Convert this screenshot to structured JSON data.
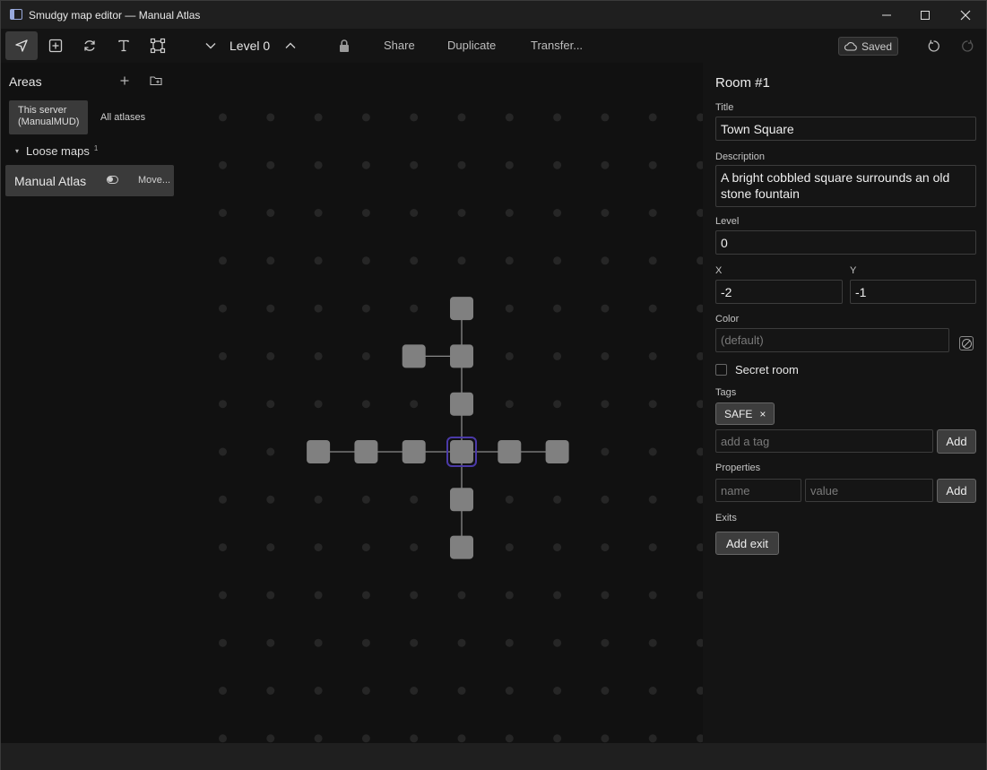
{
  "window": {
    "title": "Smudgy map editor — Manual Atlas",
    "minimize": "—",
    "maximize": "☐",
    "close": "✕"
  },
  "toolbar": {
    "tools": [
      {
        "name": "select-tool",
        "icon": "navigation-arrow-icon",
        "active": true
      },
      {
        "name": "add-room-tool",
        "icon": "plus-square-icon",
        "active": false
      },
      {
        "name": "connect-tool",
        "icon": "refresh-icon",
        "active": false
      },
      {
        "name": "text-tool",
        "icon": "text-t-icon",
        "active": false
      },
      {
        "name": "area-select-tool",
        "icon": "frame-select-icon",
        "active": false
      }
    ],
    "level_label": "Level 0",
    "share": "Share",
    "duplicate": "Duplicate",
    "transfer": "Transfer...",
    "saved": "Saved"
  },
  "sidebar": {
    "title": "Areas",
    "tabs": {
      "this_server": "This server (ManualMUD)",
      "all_atlases": "All atlases"
    },
    "loose_maps": "Loose maps",
    "loose_maps_count": "1",
    "atlas_name": "Manual Atlas",
    "atlas_move": "Move..."
  },
  "map": {
    "rooms": [
      {
        "id": "r-north2",
        "x": 0,
        "y": -3
      },
      {
        "id": "r-north1",
        "x": 0,
        "y": -2
      },
      {
        "id": "r-northwest",
        "x": -1,
        "y": -2
      },
      {
        "id": "r-north0",
        "x": 0,
        "y": -1
      },
      {
        "id": "r-center",
        "x": 0,
        "y": 0,
        "selected": true
      },
      {
        "id": "r-west1",
        "x": -1,
        "y": 0
      },
      {
        "id": "r-west2",
        "x": -2,
        "y": 0
      },
      {
        "id": "r-west3",
        "x": -3,
        "y": 0
      },
      {
        "id": "r-east1",
        "x": 1,
        "y": 0
      },
      {
        "id": "r-east2",
        "x": 2,
        "y": 0
      },
      {
        "id": "r-south1",
        "x": 0,
        "y": 1
      },
      {
        "id": "r-south2",
        "x": 0,
        "y": 2
      }
    ],
    "exits": [
      [
        "r-north2",
        "r-north1"
      ],
      [
        "r-northwest",
        "r-north1"
      ],
      [
        "r-north1",
        "r-north0"
      ],
      [
        "r-north0",
        "r-center"
      ],
      [
        "r-west3",
        "r-west2"
      ],
      [
        "r-west2",
        "r-west1"
      ],
      [
        "r-west1",
        "r-center"
      ],
      [
        "r-center",
        "r-east1"
      ],
      [
        "r-east1",
        "r-east2"
      ],
      [
        "r-center",
        "r-south1"
      ],
      [
        "r-south1",
        "r-south2"
      ]
    ],
    "colors": {
      "room": "#808080",
      "selected_outline": "#4b3aa8",
      "exit_line": "#8a8a8a",
      "grid_dot": "#262626"
    }
  },
  "room_panel": {
    "heading": "Room #1",
    "title_label": "Title",
    "title_value": "Town Square",
    "description_label": "Description",
    "description_value": "A bright cobbled square surrounds an old stone fountain",
    "level_label": "Level",
    "level_value": "0",
    "x_label": "X",
    "x_value": "-2",
    "y_label": "Y",
    "y_value": "-1",
    "color_label": "Color",
    "color_placeholder": "(default)",
    "secret_room_label": "Secret room",
    "tags_label": "Tags",
    "tags": [
      "SAFE"
    ],
    "tag_remove": "×",
    "tag_placeholder": "add a tag",
    "tag_add": "Add",
    "properties_label": "Properties",
    "prop_name_placeholder": "name",
    "prop_value_placeholder": "value",
    "prop_add": "Add",
    "exits_label": "Exits",
    "add_exit": "Add exit"
  }
}
